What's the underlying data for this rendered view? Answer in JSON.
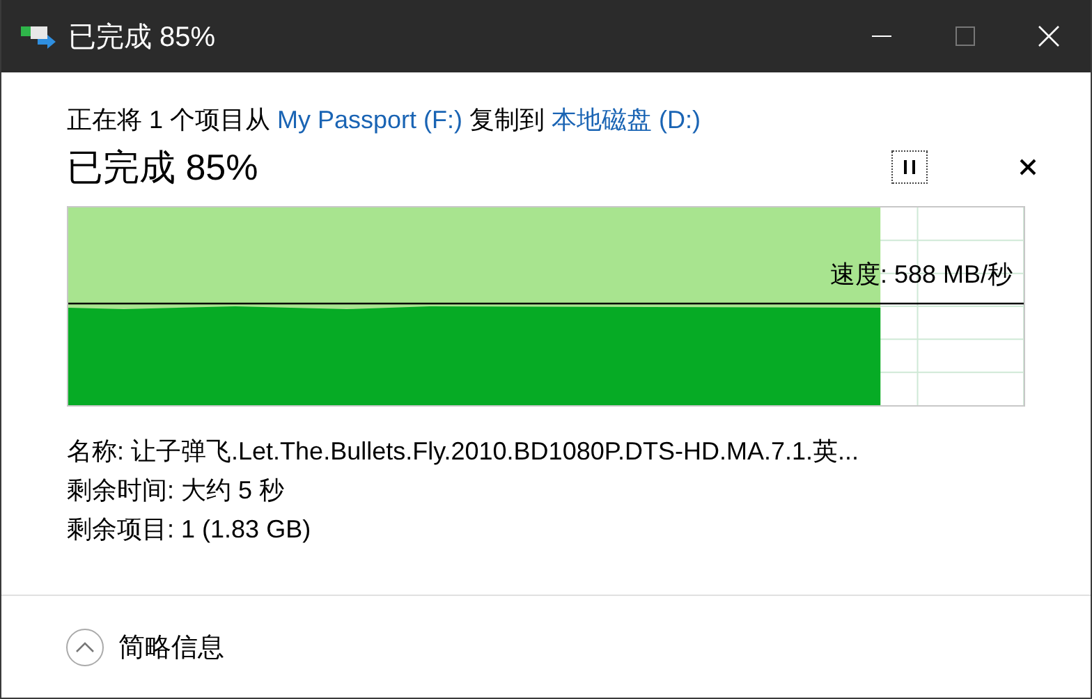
{
  "window": {
    "title": "已完成 85%"
  },
  "header": {
    "segments": [
      {
        "kind": "text",
        "text": "正在将 1 个项目从 "
      },
      {
        "kind": "link",
        "text": "My Passport (F:)"
      },
      {
        "kind": "text",
        "text": " 复制到 "
      },
      {
        "kind": "link",
        "text": "本地磁盘 (D:)"
      }
    ],
    "status": "已完成 85%"
  },
  "progress": {
    "level": 0.85,
    "speed": "速度: 588 MB/秒"
  },
  "details": [
    {
      "label": "名称:",
      "value": "让子弹飞.Let.The.Bullets.Fly.2010.BD1080P.DTS-HD.MA.7.1.英..."
    },
    {
      "label": "剩余时间:",
      "value": "大约 5 秒"
    },
    {
      "label": "剩余项目:",
      "value": "1 (1.83 GB)"
    }
  ],
  "footer": {
    "toggle": "简略信息",
    "expanded": true
  }
}
